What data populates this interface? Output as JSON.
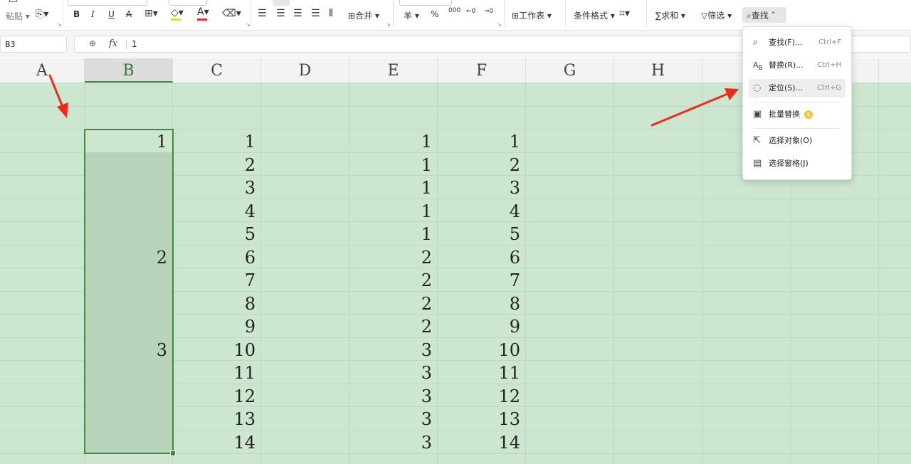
{
  "ribbon": {
    "paste_label": "粘贴",
    "bold": "B",
    "italic": "I",
    "underline": "U",
    "strike": "A",
    "merge_label": "合并",
    "currency_symbol": "羊",
    "percent": "%",
    "thousands": "000",
    "worksheet_label": "工作表",
    "cond_format_label": "条件格式",
    "sum_label": "求和",
    "filter_label": "筛选",
    "find_label": "查找"
  },
  "formula_bar": {
    "name_box": "B3",
    "fx": "fx",
    "value": "1"
  },
  "columns": [
    "A",
    "B",
    "C",
    "D",
    "E",
    "F",
    "G",
    "H"
  ],
  "grid": {
    "col_b": [
      "1",
      "",
      "",
      "",
      "",
      "2",
      "",
      "",
      "",
      "3",
      "",
      "",
      "",
      ""
    ],
    "col_c": [
      "1",
      "2",
      "3",
      "4",
      "5",
      "6",
      "7",
      "8",
      "9",
      "10",
      "11",
      "12",
      "13",
      "14"
    ],
    "col_e": [
      "1",
      "1",
      "1",
      "1",
      "1",
      "2",
      "2",
      "2",
      "2",
      "3",
      "3",
      "3",
      "3",
      "3"
    ],
    "col_f": [
      "1",
      "2",
      "3",
      "4",
      "5",
      "6",
      "7",
      "8",
      "9",
      "10",
      "11",
      "12",
      "13",
      "14"
    ]
  },
  "find_menu": {
    "items": [
      {
        "label": "查找(F)...",
        "shortcut": "Ctrl+F",
        "icon": "search-icon"
      },
      {
        "label": "替换(R)...",
        "shortcut": "Ctrl+H",
        "icon": "replace-icon"
      },
      {
        "label": "定位(S)...",
        "shortcut": "Ctrl+G",
        "icon": "locate-icon"
      },
      {
        "label": "批量替换",
        "shortcut": "",
        "icon": "batch-replace-icon"
      },
      {
        "label": "选择对象(O)",
        "shortcut": "",
        "icon": "select-object-icon"
      },
      {
        "label": "选择窗格(J)",
        "shortcut": "",
        "icon": "selection-pane-icon"
      }
    ]
  },
  "colors": {
    "sheet_background": "#cde6cf",
    "selection_border": "#3d8c3e",
    "arrow": "#ee2a1f"
  }
}
